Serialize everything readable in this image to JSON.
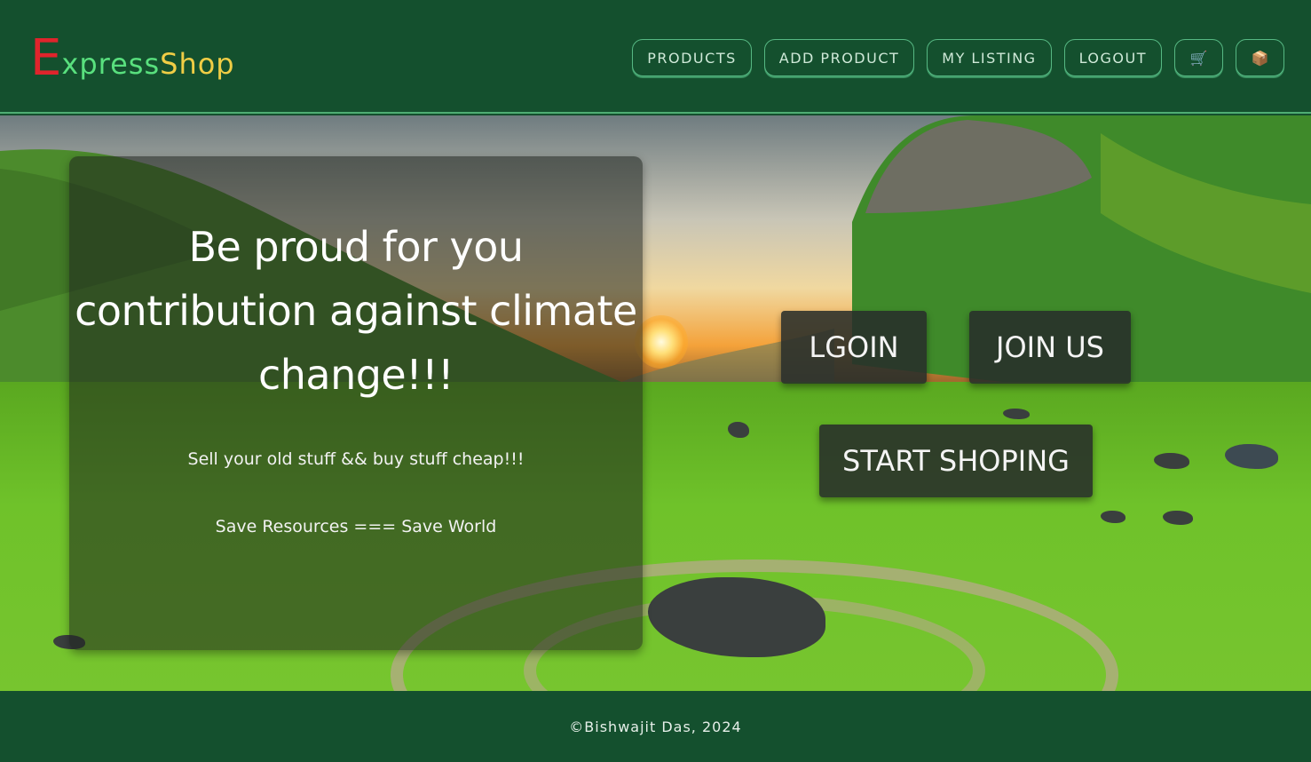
{
  "header": {
    "logo": {
      "first_letter": "E",
      "part1": "xpress",
      "part2": "Shop"
    },
    "nav": [
      {
        "label": "PRODUCTS"
      },
      {
        "label": "ADD PRODUCT"
      },
      {
        "label": "MY LISTING"
      },
      {
        "label": "LOGOUT"
      }
    ],
    "cart_icon": "🛒",
    "orders_icon": "📦"
  },
  "hero": {
    "headline": "Be proud for you contribution against climate change!!!",
    "tagline1": "Sell your old stuff && buy stuff cheap!!!",
    "tagline2": "Save Resources === Save World",
    "login_label": "LGOIN",
    "join_label": "JOIN US",
    "shop_label": "START SHOPING"
  },
  "footer": {
    "text": "©Bishwajit Das, 2024"
  },
  "colors": {
    "header_bg": "#14502e",
    "logo_e": "#e0242c",
    "logo_xpress": "#59e07e",
    "logo_shop": "#f0cd45",
    "nav_border": "#56b883"
  }
}
